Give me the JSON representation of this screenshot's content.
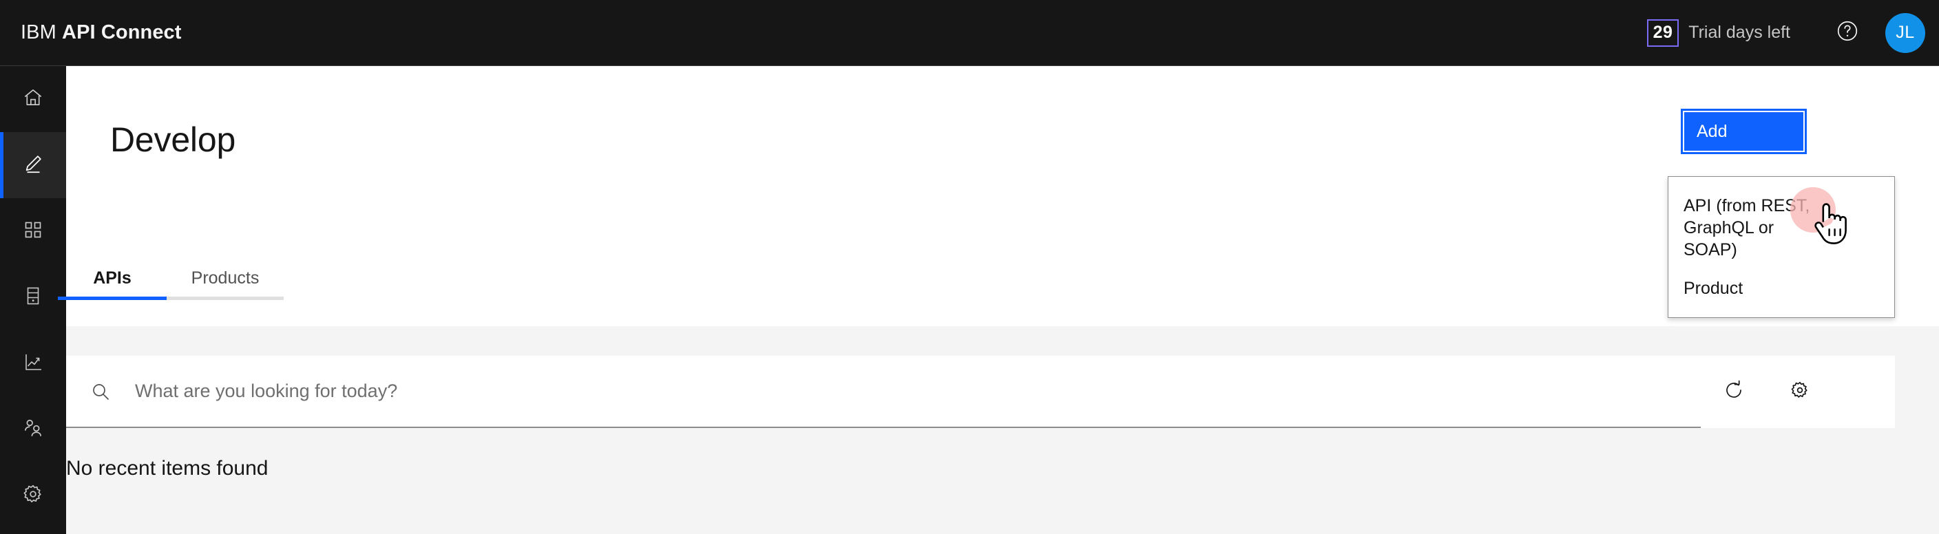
{
  "header": {
    "brand_light": "IBM",
    "brand_bold": "API Connect",
    "trial_count": "29",
    "trial_label": "Trial days left",
    "help_icon": "help-circle-icon",
    "avatar_initials": "JL",
    "avatar_color": "#1192e8",
    "background": "#161616"
  },
  "sidebar": {
    "items": [
      {
        "icon": "home-icon",
        "active": false
      },
      {
        "icon": "pencil-edit-icon",
        "active": true
      },
      {
        "icon": "apps-grid-icon",
        "active": false
      },
      {
        "icon": "server-rack-icon",
        "active": false
      },
      {
        "icon": "analytics-chart-icon",
        "active": false
      },
      {
        "icon": "users-group-icon",
        "active": false
      },
      {
        "icon": "settings-gear-icon",
        "active": false
      }
    ],
    "active_indicator_color": "#0f62fe"
  },
  "main": {
    "page_title": "Develop",
    "tabs": [
      {
        "label": "APIs",
        "active": true
      },
      {
        "label": "Products",
        "active": false
      }
    ],
    "active_tab_color": "#0f62fe",
    "search": {
      "placeholder": "What are you looking for today?",
      "value": "",
      "search_icon": "search-icon",
      "refresh_icon": "refresh-icon",
      "settings_icon": "settings-gear-icon"
    },
    "empty_state_text": "No recent items found"
  },
  "add_control": {
    "button_label": "Add",
    "button_color": "#0f62fe",
    "menu_items": [
      {
        "label": "API (from REST, GraphQL or SOAP)"
      },
      {
        "label": "Product"
      }
    ]
  },
  "pointer": {
    "cursor": "pointing-hand-cursor",
    "click_halo_color": "#f9b3b3"
  }
}
